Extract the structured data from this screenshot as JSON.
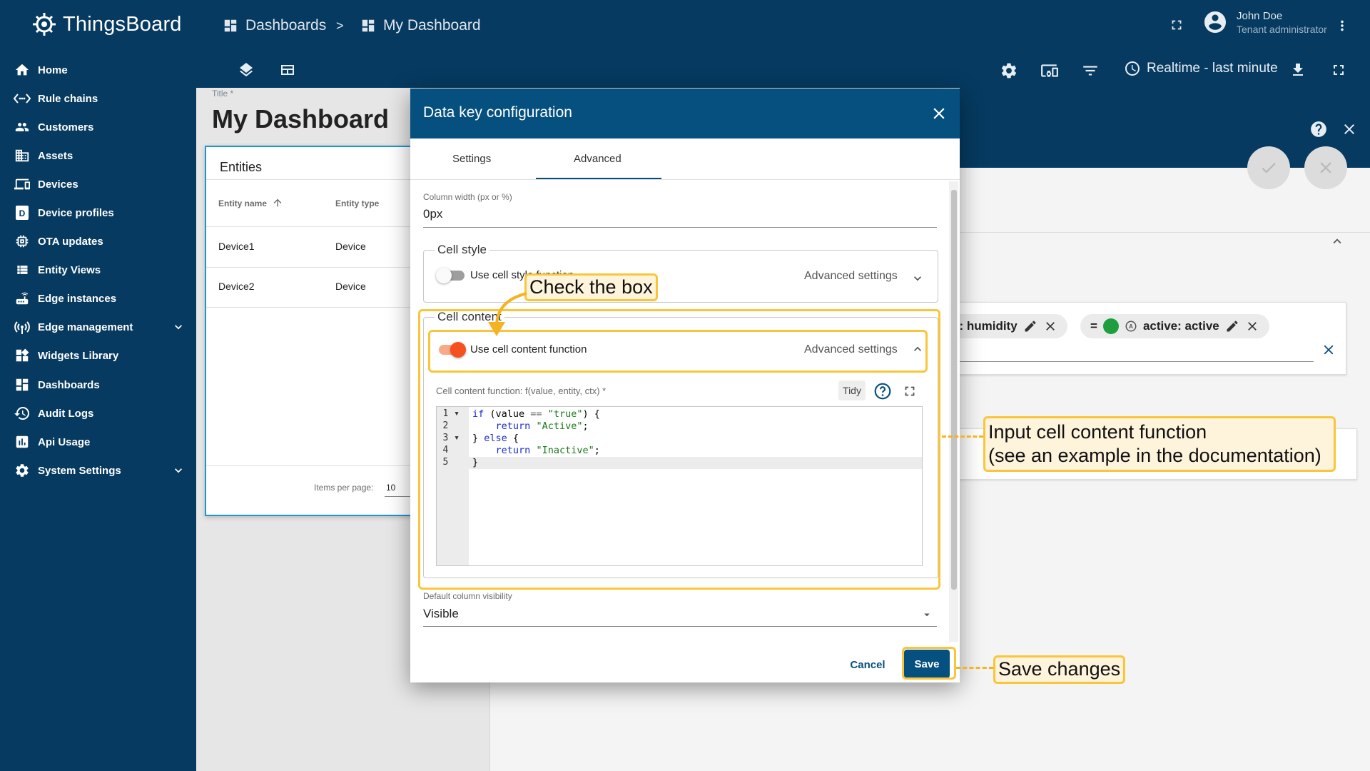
{
  "app": {
    "name": "ThingsBoard",
    "breadcrumb": [
      {
        "label": "Dashboards"
      },
      {
        "label": "My Dashboard"
      }
    ],
    "breadcrumb_sep": ">",
    "user": {
      "name": "John Doe",
      "role": "Tenant administrator"
    },
    "timewindow": "Realtime - last minute"
  },
  "sidebar": {
    "items": [
      {
        "label": "Home",
        "icon": "home-icon"
      },
      {
        "label": "Rule chains",
        "icon": "rule-chain-icon"
      },
      {
        "label": "Customers",
        "icon": "customers-icon"
      },
      {
        "label": "Assets",
        "icon": "assets-icon"
      },
      {
        "label": "Devices",
        "icon": "devices-icon"
      },
      {
        "label": "Device profiles",
        "icon": "device-profile-icon"
      },
      {
        "label": "OTA updates",
        "icon": "ota-icon"
      },
      {
        "label": "Entity Views",
        "icon": "entity-views-icon"
      },
      {
        "label": "Edge instances",
        "icon": "edge-icon"
      },
      {
        "label": "Edge management",
        "icon": "edge-management-icon"
      },
      {
        "label": "Widgets Library",
        "icon": "widgets-icon"
      },
      {
        "label": "Dashboards",
        "icon": "dashboards-icon"
      },
      {
        "label": "Audit Logs",
        "icon": "audit-icon"
      },
      {
        "label": "Api Usage",
        "icon": "api-usage-icon"
      },
      {
        "label": "System Settings",
        "icon": "settings-icon"
      }
    ]
  },
  "dashboard": {
    "title_label": "Title *",
    "title": "My Dashboard",
    "entities_widget": {
      "title": "Entities",
      "columns": [
        "Entity name",
        "Entity type"
      ],
      "rows": [
        [
          "Device1",
          "Device"
        ],
        [
          "Device2",
          "Device"
        ]
      ],
      "items_per_page_label": "Items per page:",
      "items_per_page_value": "10"
    }
  },
  "right_panel": {
    "chips": [
      {
        "label": "y: humidity"
      },
      {
        "label": "active: active",
        "operator": "=",
        "dot_color": "#1e9e3e"
      }
    ]
  },
  "dialog": {
    "title": "Data key configuration",
    "tabs": [
      "Settings",
      "Advanced"
    ],
    "active_tab": "Advanced",
    "column_width_label": "Column width (px or %)",
    "column_width_value": "0px",
    "cell_style": {
      "legend": "Cell style",
      "toggle_label": "Use cell style function",
      "toggle_on": false,
      "advanced": "Advanced settings"
    },
    "cell_content": {
      "legend": "Cell content",
      "toggle_label": "Use cell content function",
      "toggle_on": true,
      "advanced": "Advanced settings",
      "function_label": "Cell content function: f(value, entity, ctx) *",
      "tidy": "Tidy",
      "code": [
        "if (value == \"true\") {",
        "    return \"Active\";",
        "} else {",
        "    return \"Inactive\";",
        "}"
      ]
    },
    "visibility_label": "Default column visibility",
    "visibility_value": "Visible",
    "cancel": "Cancel",
    "save": "Save"
  },
  "annotations": {
    "check_box": "Check the box",
    "input_function_1": "Input cell content function",
    "input_function_2": "(see an example in the documentation)",
    "save_changes": "Save changes"
  },
  "colors": {
    "primary": "#063a60",
    "dialog_header": "#05507f",
    "toggle_on": "#f4511e",
    "highlight": "#f9c63b"
  }
}
